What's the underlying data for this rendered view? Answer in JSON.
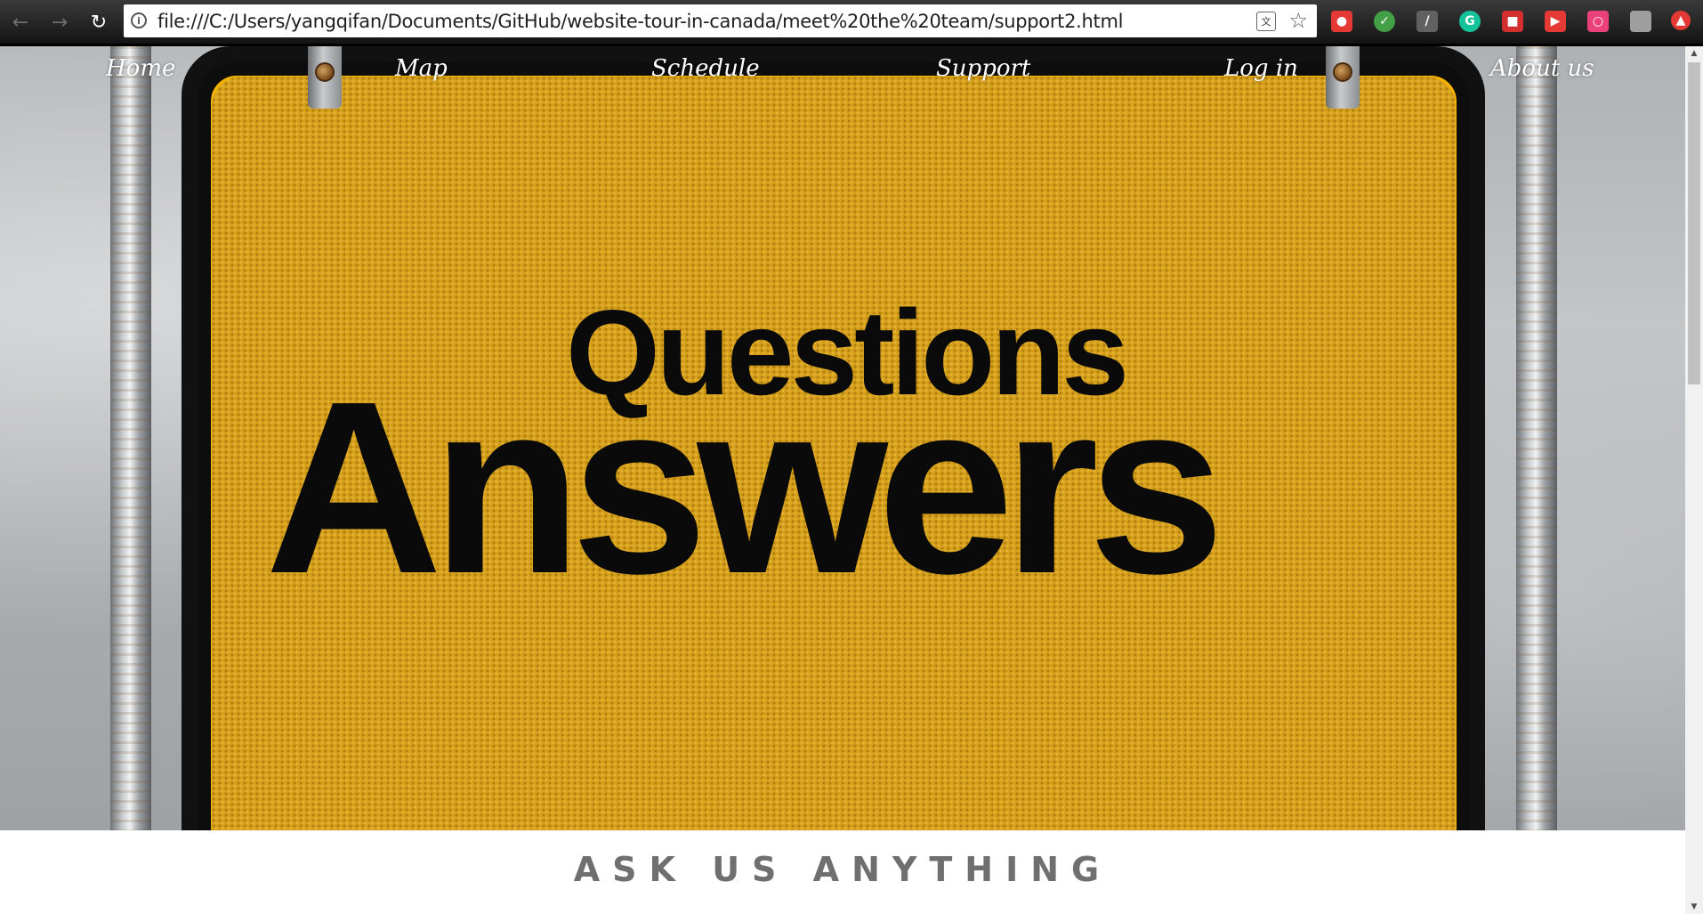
{
  "browser": {
    "url": "file:///C:/Users/yangqifan/Documents/GitHub/website-tour-in-canada/meet%20the%20team/support2.html",
    "icons": {
      "back": "back-arrow-icon",
      "forward": "forward-arrow-icon",
      "reload": "reload-icon",
      "info": "info-icon",
      "translate": "translate-icon",
      "bookmark": "star-icon"
    },
    "extensions": [
      {
        "name": "extension-red-avatar",
        "color": "#e53935"
      },
      {
        "name": "extension-checkmark",
        "color": "#43a047"
      },
      {
        "name": "extension-pdf",
        "color": "#616161"
      },
      {
        "name": "extension-grammarly",
        "color": "#15c39a"
      },
      {
        "name": "extension-red-square",
        "color": "#d32f2f"
      },
      {
        "name": "extension-red-play",
        "color": "#e53935"
      },
      {
        "name": "extension-pink-square",
        "color": "#ec407a"
      },
      {
        "name": "extension-grey-square",
        "color": "#9e9e9e"
      },
      {
        "name": "extension-red-upload",
        "color": "#e53935"
      }
    ]
  },
  "nav": {
    "home": "Home",
    "map": "Map",
    "schedule": "Schedule",
    "support": "Support",
    "login": "Log in",
    "about": "About us"
  },
  "hero": {
    "sign_word_1": "Questions",
    "sign_word_2": "Answers",
    "sign_color": "#d7a01b"
  },
  "section": {
    "heading": "ASK US ANYTHING",
    "heading_color": "#6f6f6f"
  }
}
